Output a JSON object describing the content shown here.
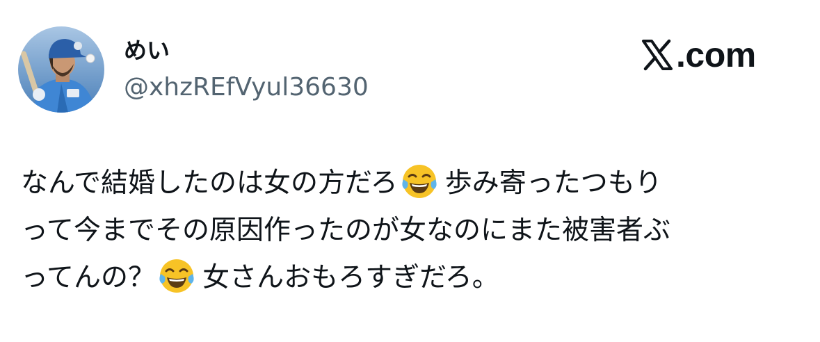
{
  "author": {
    "display_name": "めい",
    "handle": "@xhzREfVyul36630",
    "avatar_icon": "baseball-player-avatar"
  },
  "brand": {
    "icon": "x-logo-icon",
    "text": ".com"
  },
  "tweet": {
    "segments": {
      "line1_text": "なんで結婚したのは女の方だろ",
      "line1_after": "歩み寄ったつもり",
      "line2_text": "って今までその原因作ったのが女なのにまた被害者ぶ",
      "line3_text": "ってんの？",
      "line3_after": "女さんおもろすぎだろ。"
    },
    "emoji": "face-with-tears-of-joy-icon"
  },
  "colors": {
    "text": "#0f1419",
    "secondary": "#536471",
    "emoji_face": "#f7c326",
    "tears": "#5fb4ea",
    "avatar_sky": "#6fa8dc",
    "jersey": "#3f86d4"
  }
}
